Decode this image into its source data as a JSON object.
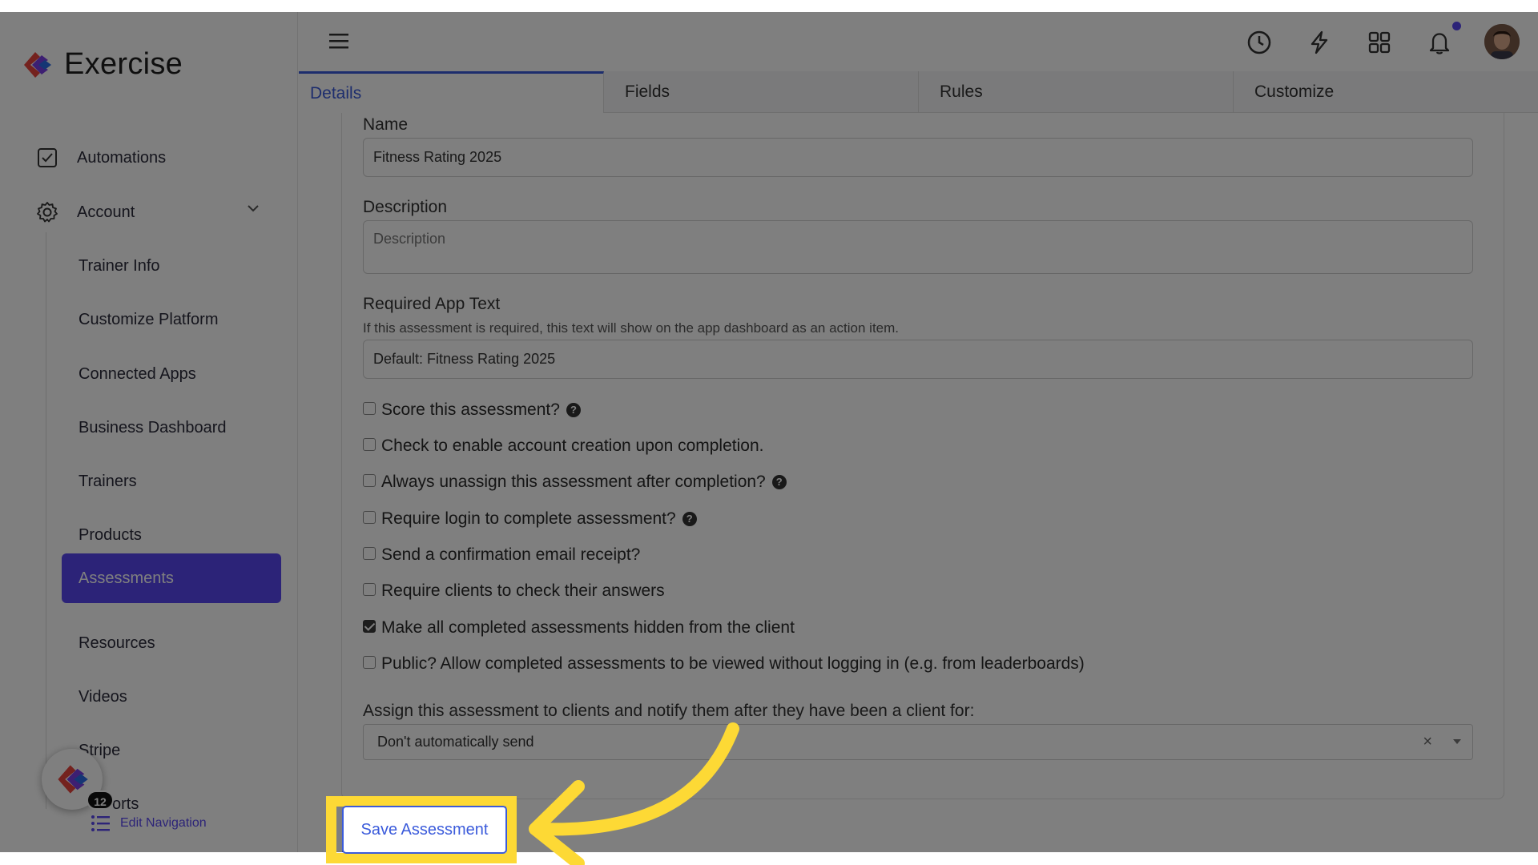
{
  "app": {
    "logo_text": "Exercise"
  },
  "sidebar": {
    "items": [
      {
        "label": "Automations",
        "icon": "checkbox-icon"
      },
      {
        "label": "Account",
        "icon": "gear-icon"
      }
    ],
    "account_subitems": [
      "Trainer Info",
      "Customize Platform",
      "Connected Apps",
      "Business Dashboard",
      "Trainers",
      "Products",
      "Assessments",
      "Resources",
      "Videos",
      "Stripe",
      "orts"
    ],
    "active_subitem": "Assessments",
    "help_badge_count": "12",
    "edit_navigation_label": "Edit Navigation"
  },
  "topbar": {
    "icons": [
      "menu-icon",
      "clock-icon",
      "lightning-icon",
      "grid-icon",
      "bell-icon"
    ],
    "accent": "#5846f1"
  },
  "tabs": [
    {
      "label": "Details",
      "active": true
    },
    {
      "label": "Fields",
      "active": false
    },
    {
      "label": "Rules",
      "active": false
    },
    {
      "label": "Customize",
      "active": false
    }
  ],
  "form": {
    "name_label": "Name",
    "name_value": "Fitness Rating 2025",
    "description_label": "Description",
    "description_placeholder": "Description",
    "required_text_label": "Required App Text",
    "required_text_hint": "If this assessment is required, this text will show on the app dashboard as an action item.",
    "required_text_value": "Default: Fitness Rating 2025",
    "checkboxes": [
      {
        "label": "Score this assessment?",
        "checked": false,
        "help": true
      },
      {
        "label": "Check to enable account creation upon completion.",
        "checked": false,
        "help": false
      },
      {
        "label": "Always unassign this assessment after completion?",
        "checked": false,
        "help": true
      },
      {
        "label": "Require login to complete assessment?",
        "checked": false,
        "help": true
      },
      {
        "label": "Send a confirmation email receipt?",
        "checked": false,
        "help": false
      },
      {
        "label": "Require clients to check their answers",
        "checked": false,
        "help": false
      },
      {
        "label": "Make all completed assessments hidden from the client",
        "checked": true,
        "help": false
      },
      {
        "label": "Public? Allow completed assessments to be viewed without logging in (e.g. from leaderboards)",
        "checked": false,
        "help": false
      }
    ],
    "help_glyph": "?",
    "assign_label": "Assign this assessment to clients and notify them after they have been a client for:",
    "assign_value": "Don't automatically send",
    "clear_glyph": "×",
    "save_label": "Save Assessment"
  },
  "highlight": {
    "color": "#fdd935",
    "target": "save-assessment-button"
  }
}
